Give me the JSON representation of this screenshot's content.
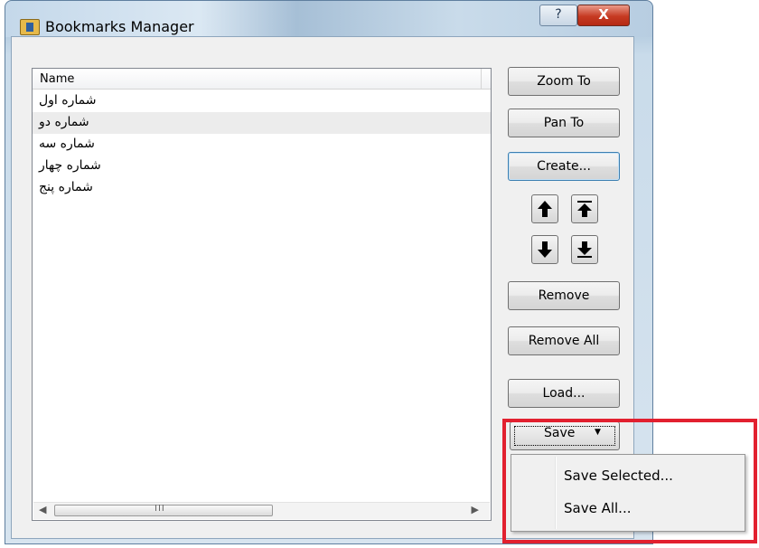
{
  "window": {
    "title": "Bookmarks Manager",
    "help_glyph": "?",
    "close_glyph": "X"
  },
  "list": {
    "column_header": "Name",
    "items": [
      {
        "label": "شماره اول",
        "selected": false
      },
      {
        "label": "شماره دو",
        "selected": true
      },
      {
        "label": "شماره سه",
        "selected": false
      },
      {
        "label": "شماره چهار",
        "selected": false
      },
      {
        "label": "شماره پنج",
        "selected": false
      }
    ],
    "scroll_grip": "III"
  },
  "buttons": {
    "zoom_to": "Zoom To",
    "pan_to": "Pan To",
    "create": "Create...",
    "remove": "Remove",
    "remove_all": "Remove All",
    "load": "Load...",
    "save": "Save"
  },
  "save_menu": {
    "items": [
      "Save Selected...",
      "Save All..."
    ]
  },
  "colors": {
    "highlight": "#e2202f",
    "close_button": "#c63a22"
  },
  "icons": [
    "move-up-icon",
    "move-to-top-icon",
    "move-down-icon",
    "move-to-bottom-icon",
    "dropdown-caret-icon",
    "scroll-left-icon",
    "scroll-right-icon"
  ]
}
